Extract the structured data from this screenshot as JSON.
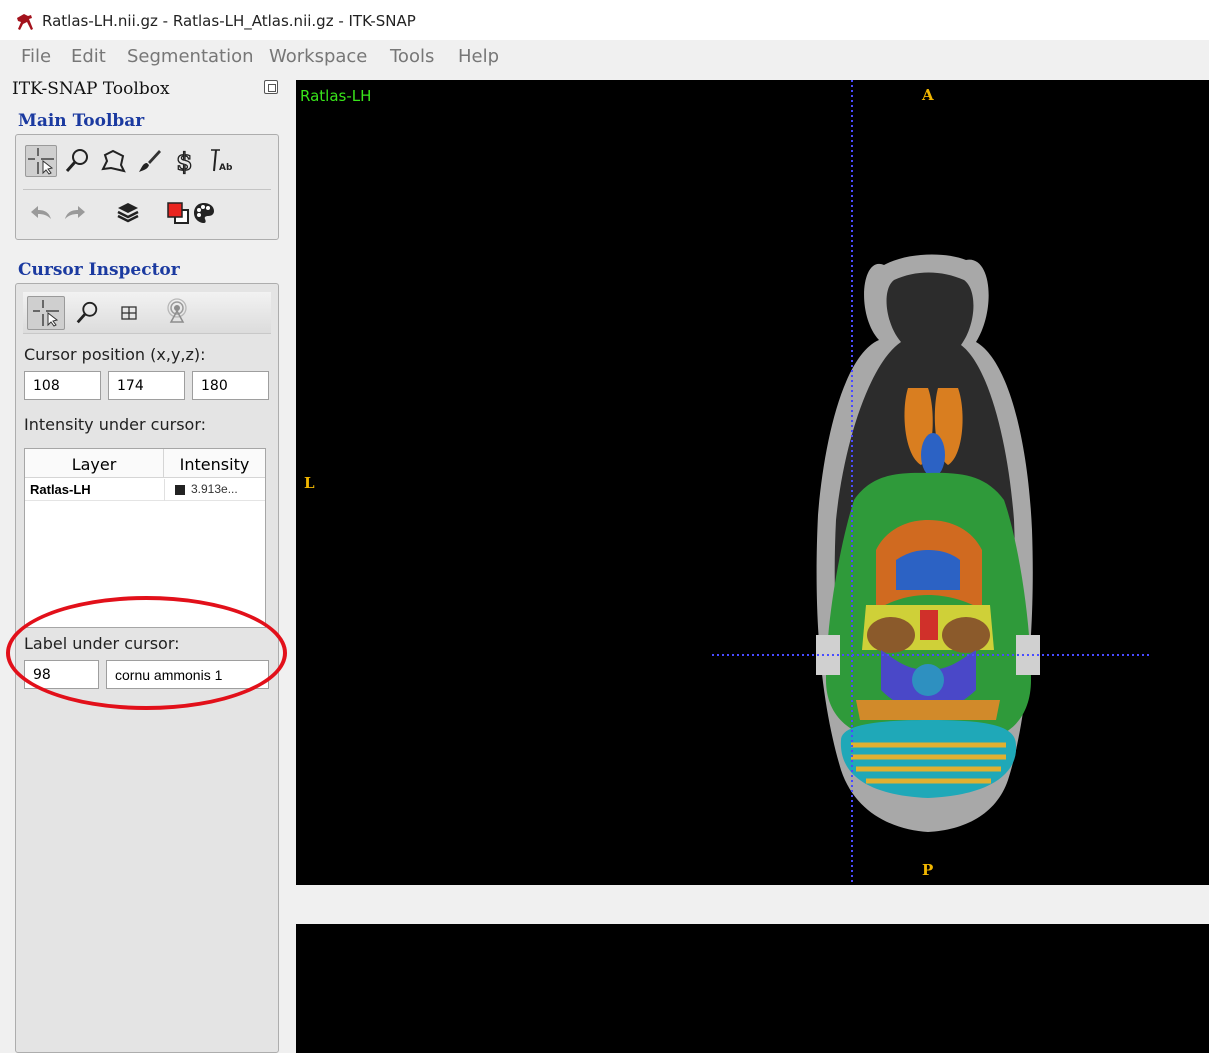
{
  "window": {
    "title": "Ratlas-LH.nii.gz - Ratlas-LH_Atlas.nii.gz - ITK-SNAP"
  },
  "menu": [
    "File",
    "Edit",
    "Segmentation",
    "Workspace",
    "Tools",
    "Help"
  ],
  "toolbox": {
    "title": "ITK-SNAP Toolbox",
    "main_toolbar": {
      "title": "Main Toolbar",
      "row1_icons": [
        "crosshair-cursor-icon",
        "zoom-icon",
        "polygon-icon",
        "paintbrush-icon",
        "snake-icon",
        "annotation-icon"
      ],
      "row2_icons": [
        "undo-icon",
        "redo-icon",
        "layers-icon",
        "label-color-icon",
        "palette-icon"
      ]
    },
    "cursor_inspector": {
      "title": "Cursor Inspector",
      "tab_icons": [
        "crosshair-cursor-icon",
        "zoom-icon",
        "grid-icon",
        "sync-icon"
      ],
      "cursor_position_label": "Cursor position (x,y,z):",
      "cursor_position": {
        "x": "108",
        "y": "174",
        "z": "180"
      },
      "intensity_label": "Intensity under cursor:",
      "table": {
        "headers": [
          "Layer",
          "Intensity"
        ],
        "rows": [
          {
            "layer": "Ratlas-LH",
            "intensity": "3.913e..."
          }
        ]
      },
      "label_under_cursor_label": "Label under cursor:",
      "label_id": "98",
      "label_name": "cornu ammonis 1"
    }
  },
  "axial_view": {
    "layer_name": "Ratlas-LH",
    "orientation": {
      "top": "A",
      "bottom": "P",
      "left": "L"
    }
  },
  "colors": {
    "section_title": "#1b3aa0",
    "layer_name": "#39e51b",
    "orientation_markers": "#f1b600",
    "crosshair": "#4a4aff",
    "annotation_ellipse": "#e2101a"
  }
}
